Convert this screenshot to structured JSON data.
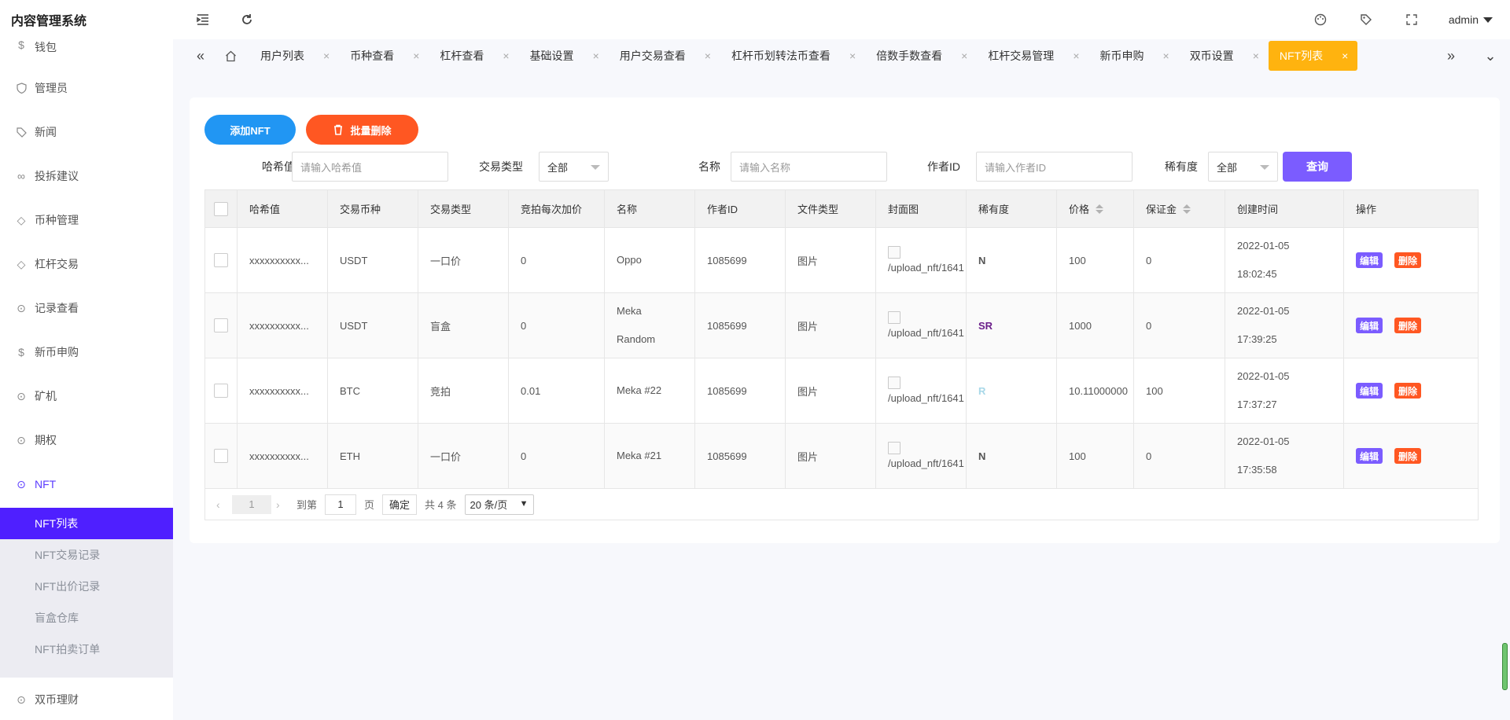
{
  "app": {
    "title": "内容管理系统",
    "user": "admin"
  },
  "sidebar": {
    "items": [
      {
        "label": "钱包",
        "icon": "dollar-circle-icon"
      },
      {
        "label": "管理员",
        "icon": "shield-icon"
      },
      {
        "label": "新闻",
        "icon": "tag-icon"
      },
      {
        "label": "投拆建议",
        "icon": "link-icon"
      },
      {
        "label": "币种管理",
        "icon": "diamond-icon"
      },
      {
        "label": "杠杆交易",
        "icon": "diamond-icon"
      },
      {
        "label": "记录查看",
        "icon": "circle-arrow-icon"
      },
      {
        "label": "新币申购",
        "icon": "dollar-circle-icon"
      },
      {
        "label": "矿机",
        "icon": "circle-arrow-icon"
      },
      {
        "label": "期权",
        "icon": "circle-arrow-icon"
      },
      {
        "label": "NFT",
        "icon": "circle-arrow-icon"
      }
    ],
    "submenu": [
      "NFT列表",
      "NFT交易记录",
      "NFT出价记录",
      "盲盒仓库",
      "NFT拍卖订单"
    ],
    "after": {
      "label": "双币理财",
      "icon": "circle-arrow-icon"
    }
  },
  "tabs": [
    "用户列表",
    "币种查看",
    "杠杆查看",
    "基础设置",
    "用户交易查看",
    "杠杆币划转法币查看",
    "倍数手数查看",
    "杠杆交易管理",
    "新币申购",
    "双币设置",
    "NFT列表"
  ],
  "toolbar": {
    "add_label": "添加NFT",
    "batch_delete_label": "批量删除"
  },
  "filters": {
    "hash_label": "哈希值",
    "hash_placeholder": "请输入哈希值",
    "trade_type_label": "交易类型",
    "trade_type_value": "全部",
    "name_label": "名称",
    "name_placeholder": "请输入名称",
    "author_label": "作者ID",
    "author_placeholder": "请输入作者ID",
    "rarity_label": "稀有度",
    "rarity_value": "全部",
    "query_label": "查询"
  },
  "table": {
    "headers": [
      "哈希值",
      "交易币种",
      "交易类型",
      "竞拍每次加价",
      "名称",
      "作者ID",
      "文件类型",
      "封面图",
      "稀有度",
      "价格",
      "保证金",
      "创建时间",
      "操作"
    ],
    "rows": [
      {
        "hash": "xxxxxxxxxx...",
        "coin": "USDT",
        "type": "一口价",
        "increment": "0",
        "name": [
          "Oppo"
        ],
        "author": "1085699",
        "file_type": "图片",
        "cover": "/upload_nft/1641",
        "rarity": "N",
        "price": "100",
        "deposit": "0",
        "date": "2022-01-05",
        "time": "18:02:45",
        "edit": "编辑",
        "delete": "删除"
      },
      {
        "hash": "xxxxxxxxxx...",
        "coin": "USDT",
        "type": "盲盒",
        "increment": "0",
        "name": [
          "Meka",
          "Random"
        ],
        "author": "1085699",
        "file_type": "图片",
        "cover": "/upload_nft/1641",
        "rarity": "SR",
        "price": "1000",
        "deposit": "0",
        "date": "2022-01-05",
        "time": "17:39:25",
        "edit": "编辑",
        "delete": "删除"
      },
      {
        "hash": "xxxxxxxxxx...",
        "coin": "BTC",
        "type": "竞拍",
        "increment": "0.01",
        "name": [
          "Meka #22"
        ],
        "author": "1085699",
        "file_type": "图片",
        "cover": "/upload_nft/1641",
        "rarity": "R",
        "price": "10.11000000",
        "deposit": "100",
        "date": "2022-01-05",
        "time": "17:37:27",
        "edit": "编辑",
        "delete": "删除"
      },
      {
        "hash": "xxxxxxxxxx...",
        "coin": "ETH",
        "type": "一口价",
        "increment": "0",
        "name": [
          "Meka #21"
        ],
        "author": "1085699",
        "file_type": "图片",
        "cover": "/upload_nft/1641",
        "rarity": "N",
        "price": "100",
        "deposit": "0",
        "date": "2022-01-05",
        "time": "17:35:58",
        "edit": "编辑",
        "delete": "删除"
      }
    ]
  },
  "rarity_colors": {
    "N": "#555555",
    "SR": "#6b1f8a",
    "R": "#a8d8e8"
  },
  "pagination": {
    "current": "1",
    "goto_label": "到第",
    "goto_value": "1",
    "page_label": "页",
    "confirm_label": "确定",
    "total_label": "共 4 条",
    "page_size": "20 条/页"
  }
}
